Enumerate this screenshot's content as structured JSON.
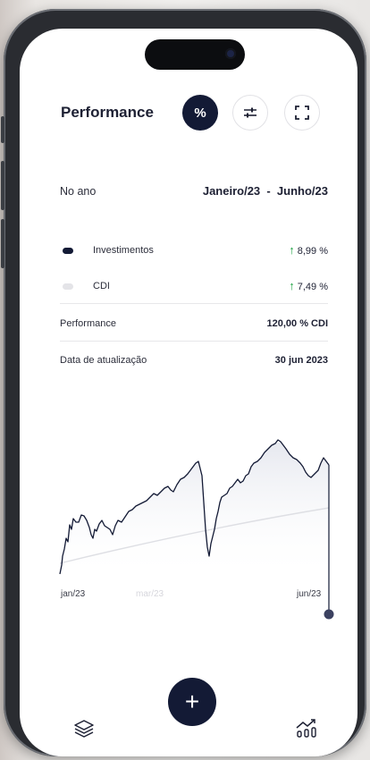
{
  "header": {
    "title": "Performance",
    "percent_label": "%"
  },
  "period": {
    "label": "No ano",
    "value": "Janeiro/23  -  Junho/23"
  },
  "legend": [
    {
      "label": "Investimentos",
      "value": "8,99 %",
      "color": "#131a35",
      "trend": "up"
    },
    {
      "label": "CDI",
      "value": "7,49 %",
      "color": "#e4e4e8",
      "trend": "up"
    }
  ],
  "performance": {
    "label": "Performance",
    "value": "120,00 % CDI"
  },
  "updated": {
    "label": "Data de atualização",
    "value": "30 jun 2023"
  },
  "chart": {
    "x_labels": [
      "jan/23",
      "mar/23",
      "jun/23"
    ],
    "line_color": "#131a35",
    "fill_color": "#eceef3",
    "cdi_color": "#dedfe4"
  },
  "bottom_nav": {
    "add_label": "+"
  },
  "icons": [
    "layers-icon",
    "filter-sliders-icon",
    "fullscreen-icon",
    "add-icon",
    "chart-trend-icon",
    "arrow-up-icon"
  ]
}
